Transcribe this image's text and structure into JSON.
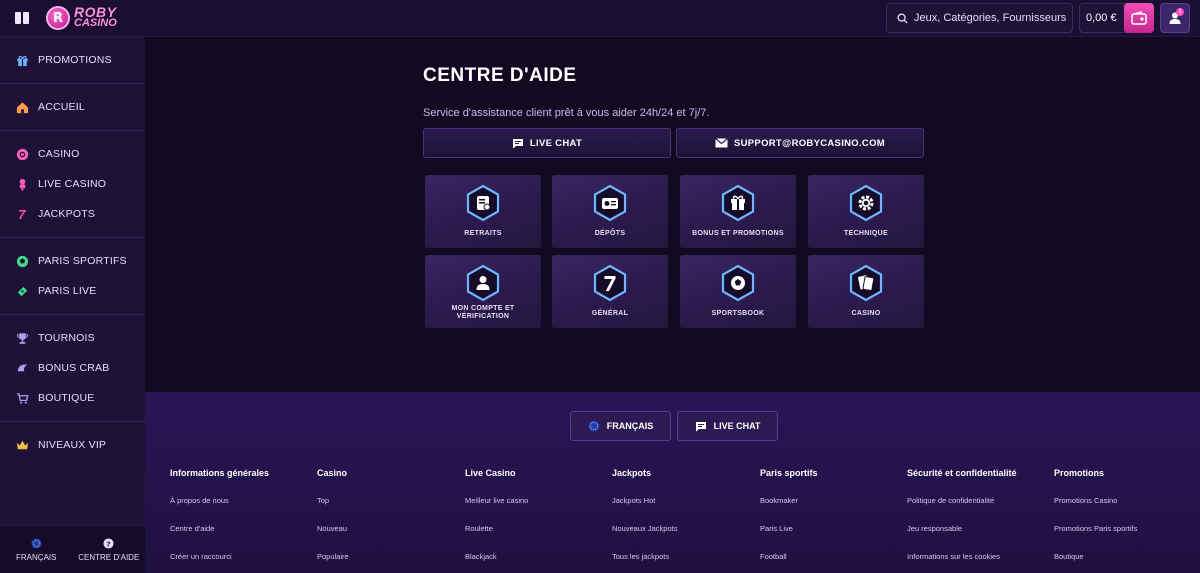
{
  "header": {
    "logo_line1": "ROBY",
    "logo_line2": "CASINO",
    "logo_badge": "R",
    "search_placeholder": "Jeux, Catégories, Fournisseurs",
    "balance": "0,00 €",
    "notifications": "1"
  },
  "sidebar": {
    "groups": [
      [
        {
          "label": "PROMOTIONS",
          "icon": "gift-icon"
        }
      ],
      [
        {
          "label": "ACCUEIL",
          "icon": "home-icon"
        }
      ],
      [
        {
          "label": "CASINO",
          "icon": "casino-chip-icon"
        },
        {
          "label": "LIVE CASINO",
          "icon": "live-casino-icon"
        },
        {
          "label": "JACKPOTS",
          "icon": "seven-icon"
        }
      ],
      [
        {
          "label": "PARIS SPORTIFS",
          "icon": "soccer-ball-icon"
        },
        {
          "label": "PARIS LIVE",
          "icon": "ticket-icon"
        }
      ],
      [
        {
          "label": "TOURNOIS",
          "icon": "trophy-icon"
        },
        {
          "label": "BONUS CRAB",
          "icon": "crab-icon"
        },
        {
          "label": "BOUTIQUE",
          "icon": "cart-icon"
        }
      ],
      [
        {
          "label": "NIVEAUX VIP",
          "icon": "crown-icon"
        }
      ]
    ],
    "bottom": {
      "language": "FRANÇAIS",
      "help": "CENTRE D'AIDE"
    }
  },
  "main": {
    "title": "CENTRE D'AIDE",
    "subtitle": "Service d'assistance client prêt à vous aider 24h/24 et 7j/7.",
    "live_chat": "LIVE CHAT",
    "email": "SUPPORT@ROBYCASINO.COM",
    "cards": [
      {
        "label": "RETRAITS",
        "icon": "withdraw-icon"
      },
      {
        "label": "DÉPÔTS",
        "icon": "deposit-icon"
      },
      {
        "label": "BONUS ET PROMOTIONS",
        "icon": "gift-icon"
      },
      {
        "label": "TECHNIQUE",
        "icon": "gear-icon"
      },
      {
        "label": "MON COMPTE ET VÉRIFICATION",
        "icon": "user-icon"
      },
      {
        "label": "GÉNÉRAL",
        "icon": "seven-icon"
      },
      {
        "label": "SPORTSBOOK",
        "icon": "soccer-ball-icon"
      },
      {
        "label": "CASINO",
        "icon": "cards-icon"
      }
    ]
  },
  "footer": {
    "language": "FRANÇAIS",
    "live_chat": "LIVE CHAT",
    "columns": [
      {
        "title": "Informations générales",
        "links": [
          "À propos de nous",
          "Centre d'aide",
          "Créer un raccourci"
        ]
      },
      {
        "title": "Casino",
        "links": [
          "Top",
          "Nouveau",
          "Populaire"
        ]
      },
      {
        "title": "Live Casino",
        "links": [
          "Meilleur live casino",
          "Roulette",
          "Blackjack"
        ]
      },
      {
        "title": "Jackpots",
        "links": [
          "Jackpots Hot",
          "Nouveaux Jackpots",
          "Tous les jackpots"
        ]
      },
      {
        "title": "Paris sportifs",
        "links": [
          "Bookmaker",
          "Paris Live",
          "Football"
        ]
      },
      {
        "title": "Sécurité et confidentialité",
        "links": [
          "Politique de confidentialité",
          "Jeu responsable",
          "Informations sur les cookies"
        ]
      },
      {
        "title": "Promotions",
        "links": [
          "Promotions Casino",
          "Promotions Paris sportifs",
          "Boutique"
        ]
      }
    ]
  },
  "colors": {
    "accent": "#ff8ee0",
    "hex_glow": "#6fb6ff",
    "deposit": "#e83ea9"
  }
}
